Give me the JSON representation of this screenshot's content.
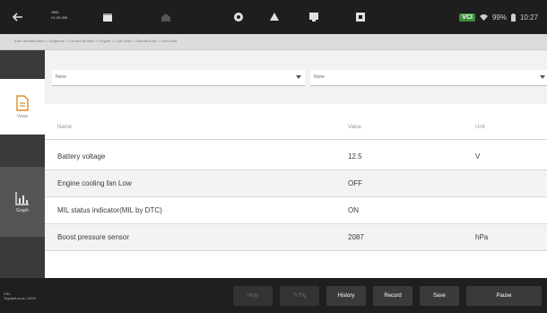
{
  "header": {
    "brand_line1": "OBD",
    "brand_line2": "V1.00.000",
    "status": {
      "vci_label": "VCI",
      "battery_text": "99%",
      "time": "10:27"
    },
    "icons": [
      "back-icon",
      "calendar-icon",
      "home-icon",
      "settings-icon",
      "camera-icon",
      "screenshot-icon",
      "print-icon"
    ]
  },
  "breadcrumb": "Auto Identification > Diagnose > Control Module > Engine > Live Data > Standard list > Live Data",
  "sidebar": {
    "tabs": [
      {
        "label": "Value"
      },
      {
        "label": "Graph"
      }
    ]
  },
  "filters": {
    "left_value": "None",
    "right_value": "None"
  },
  "table": {
    "headers": {
      "name": "Name",
      "value": "Value",
      "unit": "Unit"
    },
    "rows": [
      {
        "name": "Battery voltage",
        "value": "12.5",
        "unit": "V"
      },
      {
        "name": "Engine cooling fan Low",
        "value": "OFF",
        "unit": ""
      },
      {
        "name": "MIL status indicator(MIL by DTC)",
        "value": "ON",
        "unit": ""
      },
      {
        "name": "Boost pressure sensor",
        "value": "2087",
        "unit": "hPa"
      }
    ]
  },
  "footer": {
    "info_line1": "VIN:",
    "info_line2": "Toyota/Lexus: 100%",
    "buttons": [
      {
        "label": "Help",
        "enabled": false
      },
      {
        "label": "Tr.Flg",
        "enabled": false
      },
      {
        "label": "History",
        "enabled": true
      },
      {
        "label": "Record",
        "enabled": true
      },
      {
        "label": "Save",
        "enabled": true
      },
      {
        "label": "Pause",
        "enabled": true
      }
    ]
  }
}
